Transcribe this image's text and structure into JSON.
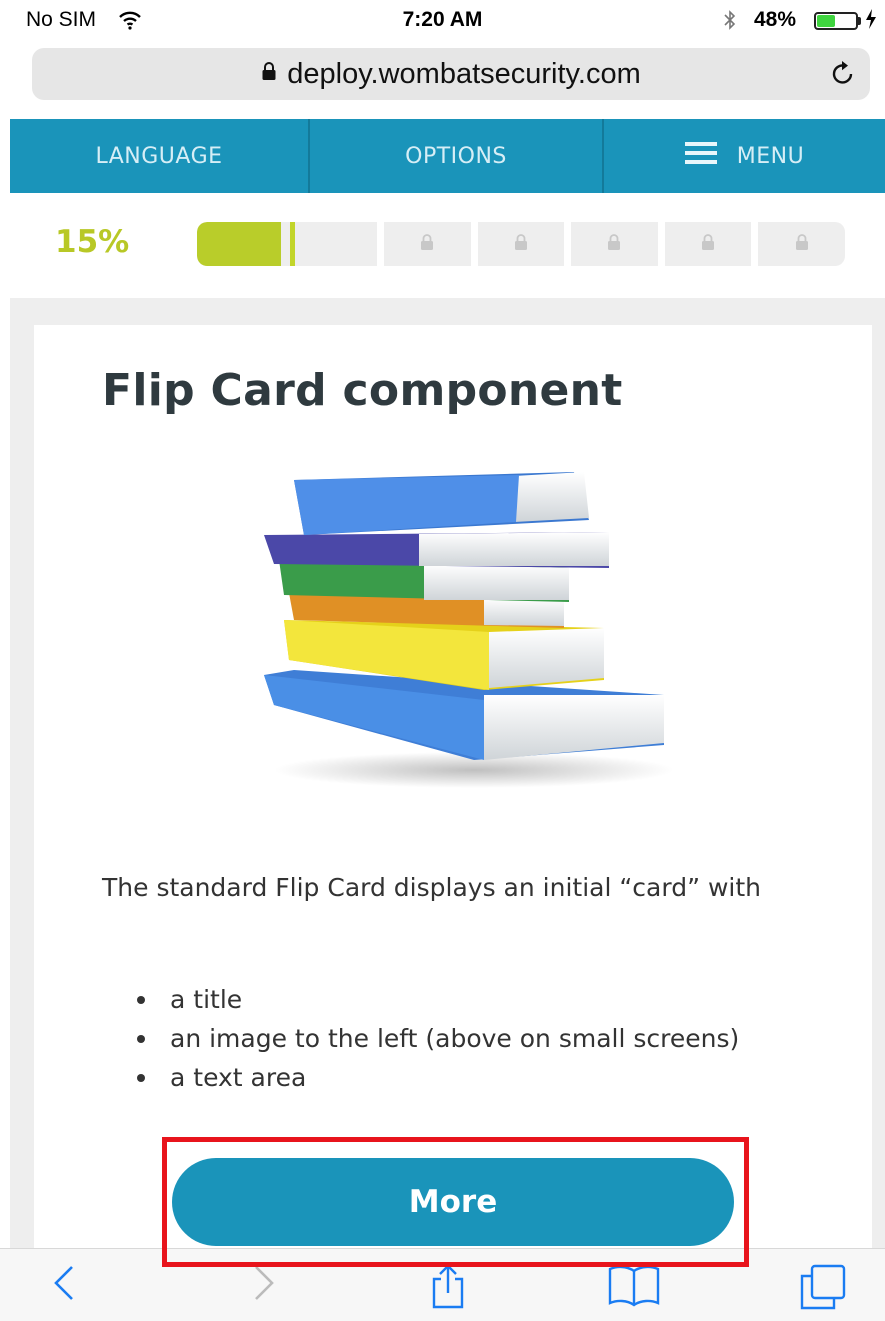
{
  "status_bar": {
    "carrier": "No SIM",
    "time": "7:20 AM",
    "battery_percent": "48%",
    "battery_level": 0.48
  },
  "url_bar": {
    "url": "deploy.wombatsecurity.com"
  },
  "nav": {
    "language": "LANGUAGE",
    "options": "OPTIONS",
    "menu": "MENU"
  },
  "progress": {
    "percent_label": "15%",
    "value": 0.15,
    "locked_sections": 5
  },
  "card": {
    "title": "Flip Card component",
    "body": "The standard Flip Card displays an initial “card” with",
    "bullets": [
      "a title",
      "an image to the left (above on small screens)",
      "a text area"
    ],
    "more_button": "More"
  },
  "colors": {
    "brand": "#1a94ba",
    "progress_accent": "#b9cd2a",
    "highlight": "#e8141c",
    "safari_blue": "#1a7cf2"
  },
  "toolbar": {
    "icons": [
      "back-icon",
      "forward-icon",
      "share-icon",
      "bookmarks-icon",
      "tabs-icon"
    ]
  }
}
